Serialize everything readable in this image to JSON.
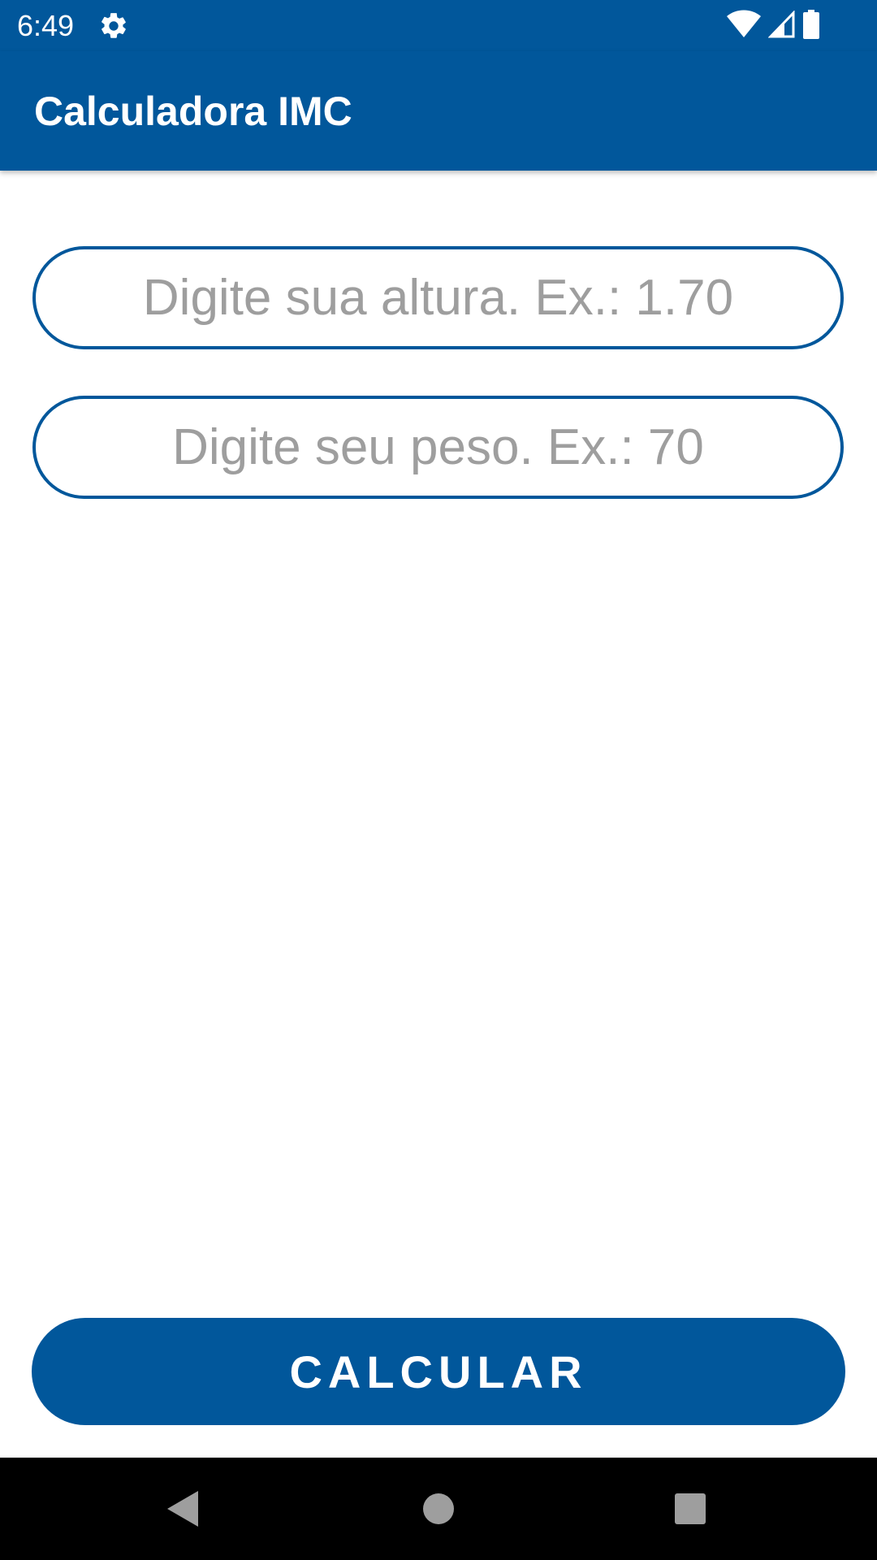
{
  "status_bar": {
    "time": "6:49",
    "icons": [
      "gear-icon",
      "wifi-icon",
      "signal-icon",
      "battery-icon"
    ]
  },
  "app_bar": {
    "title": "Calculadora IMC"
  },
  "form": {
    "height_placeholder": "Digite sua altura. Ex.: 1.70",
    "height_value": "",
    "weight_placeholder": "Digite seu peso. Ex.: 70",
    "weight_value": ""
  },
  "actions": {
    "calculate_label": "CALCULAR"
  },
  "nav_bar": {
    "icons": [
      "back-icon",
      "home-icon",
      "recents-icon"
    ]
  },
  "colors": {
    "primary": "#01579b",
    "placeholder": "#9e9e9e",
    "background": "#ffffff"
  }
}
